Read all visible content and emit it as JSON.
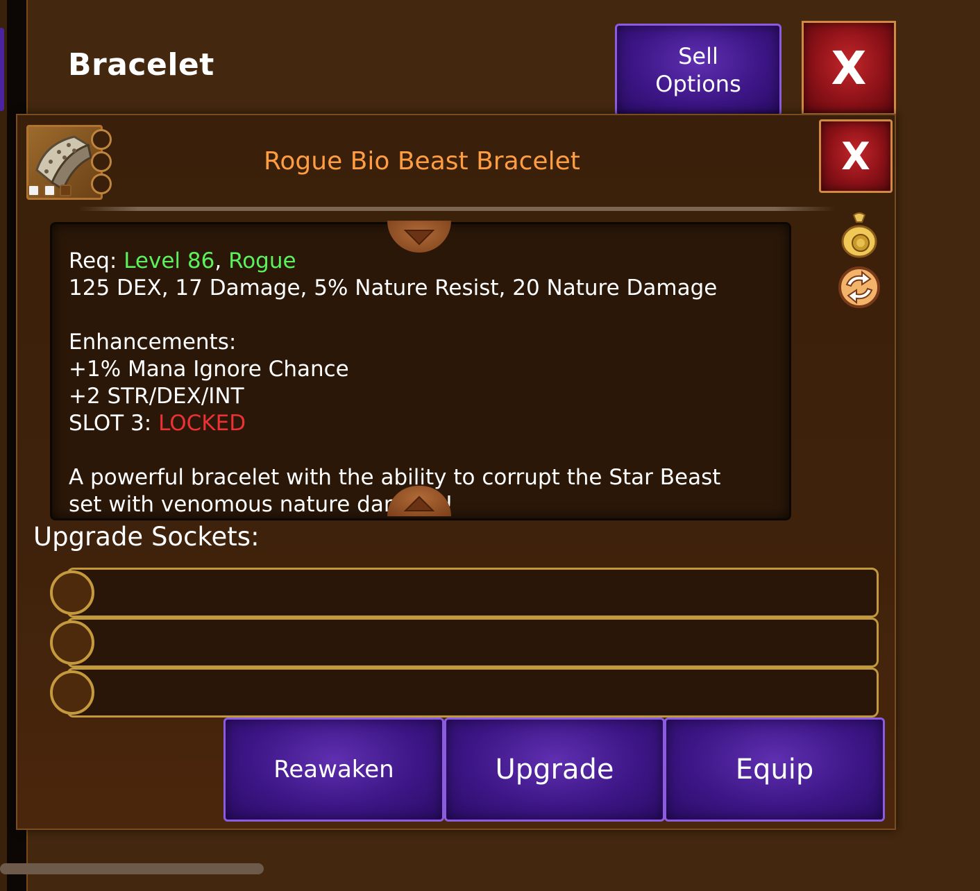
{
  "header": {
    "title": "Bracelet",
    "sell_label": "Sell\nOptions",
    "close_label": "X"
  },
  "item": {
    "name": "Rogue Bio Beast Bracelet",
    "close_label": "X",
    "sockets_unlocked": 2,
    "sockets_total": 3
  },
  "details": {
    "req_prefix": "Req: ",
    "req_level": "Level 86",
    "req_sep": ", ",
    "req_class": "Rogue",
    "stats": "125 DEX, 17 Damage, 5% Nature Resist, 20 Nature Damage",
    "enhancements_title": "Enhancements:",
    "enh_1": "+1% Mana Ignore Chance",
    "enh_2": "+2 STR/DEX/INT",
    "slot3_prefix": "SLOT 3: ",
    "slot3_status": "LOCKED",
    "description": "A powerful bracelet with the ability to corrupt the Star Beast",
    "description_cut": "set with venomous nature damage!"
  },
  "sockets": {
    "title": "Upgrade Sockets:",
    "count": 3
  },
  "actions": {
    "reawaken": "Reawaken",
    "upgrade": "Upgrade",
    "equip": "Equip"
  },
  "icons": {
    "item": "bracelet-icon",
    "sell_bag": "money-bag-icon",
    "swap": "swap-icon"
  },
  "colors": {
    "item_name": "#ff9d42",
    "requirement": "#5cf25c",
    "locked": "#ec3232",
    "button_purple": "#3d1686",
    "button_red": "#8d1218"
  }
}
